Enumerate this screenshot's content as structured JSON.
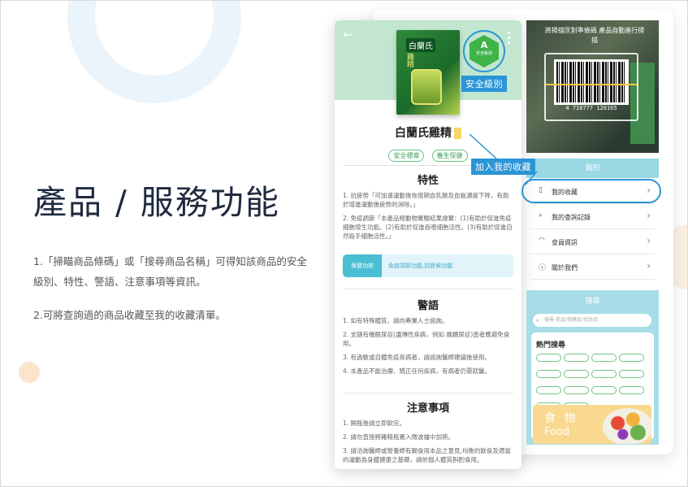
{
  "slide": {
    "heading": "產品 / 服務功能",
    "paragraph1": "1.「掃瞄商品條碼」或「搜尋商品名稱」可得知該商品的安全級別、特性、警語、注意事項等資訊。",
    "paragraph2": "2.可將查詢過的商品收藏至我的收藏清單。"
  },
  "product": {
    "box_brand": "白蘭氏",
    "box_name": "雞精",
    "safety_letter": "A",
    "safety_sub": "安全級別",
    "safety_label": "安全級別",
    "title": "白蘭氏雞精",
    "tags": [
      "安全標章",
      "養生保健"
    ]
  },
  "features": {
    "title": "特性",
    "items": [
      "1. 抗疲勞「可加速運動後恢復期血乳酸及血氨濃度下降，有助於增進運動後疲勞的消除。」",
      "2. 免疫調節「本產品經動物實驗結果證實：(1)有助於促進免疫細胞增生功能。(2)有助於促進吞噬細胞活性。(3)有助於促進自然殺手細胞活性。」"
    ],
    "func_label": "保健功效",
    "func_value": "免疫調節功能,抗疲勞功能"
  },
  "warnings": {
    "title": "警語",
    "items": [
      "1. 如有特殊體質，請向專業人士諮詢。",
      "2. 支鏈有機酸尿症(遺傳性疾病，例如 楓糖尿症)患者應避免食用。",
      "3. 有過敏或自體免疫疾病者，請諮詢醫師建議後使用。",
      "4. 本產品不能治療、矯正任何疾病，有病者仍需就醫。"
    ]
  },
  "notes": {
    "title": "注意事項",
    "items": [
      "1. 開瓶後請立即飲完。",
      "2. 請勿直接將雞精瓶置入微波爐中加熱。",
      "3. 請洽詢醫師或營養師有關食用本品之意見,均衡的飲食及適當的運動為身體健康之基礎，請依個人體質斟酌食用。"
    ]
  },
  "camera": {
    "hint": "將掃描匡對準條碼 產品自動進行掃描",
    "barcode_number": "4 710777 120165"
  },
  "my_menu": {
    "header": "我的",
    "items": [
      {
        "icon": "bookmark",
        "label": "我的收藏"
      },
      {
        "icon": "search",
        "label": "我的查詢記錄"
      },
      {
        "icon": "person",
        "label": "會員資訊"
      },
      {
        "icon": "info",
        "label": "關於我們"
      }
    ]
  },
  "callout": {
    "label": "加入我的收藏"
  },
  "search": {
    "title": "搜尋",
    "placeholder": "搜尋 商品/保健品/化妝品",
    "hot_title": "熱門搜尋",
    "food_zh": "食 物",
    "food_en": "Food"
  },
  "colors": {
    "accent": "#2b95d6",
    "green": "#3db34a",
    "teal": "#49bfd3",
    "menu_header": "#9ad8e2"
  }
}
